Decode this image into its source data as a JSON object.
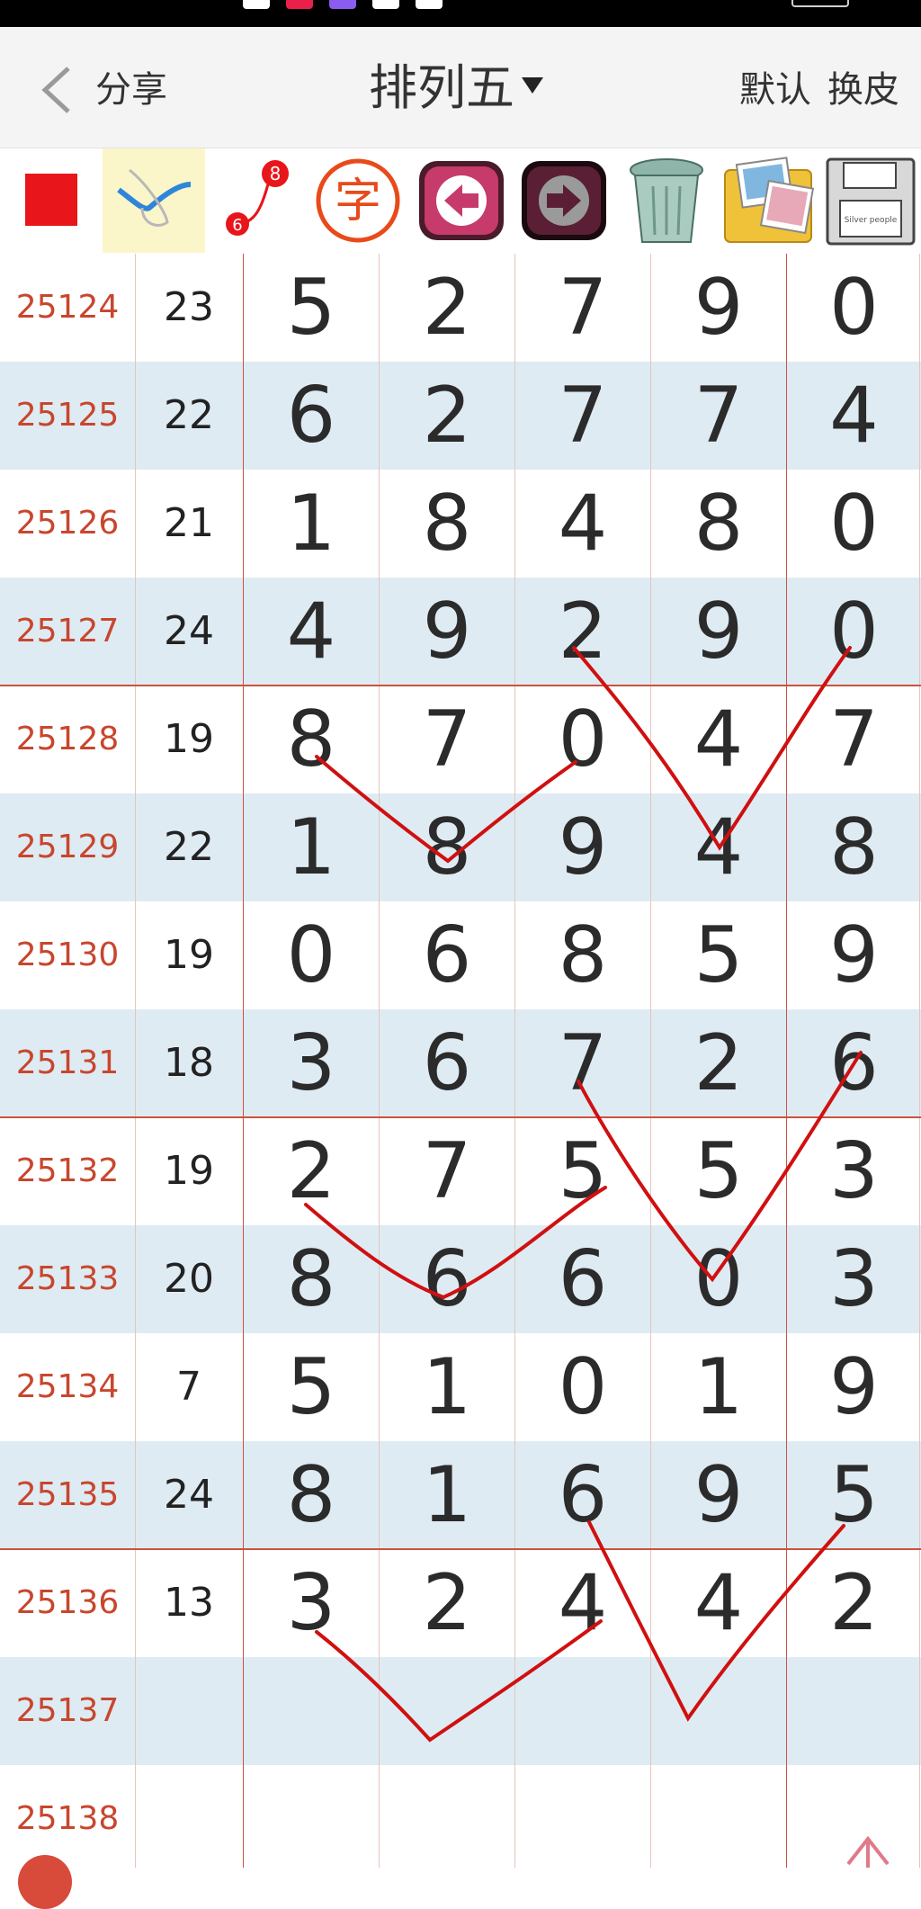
{
  "header": {
    "share_label": "分享",
    "title": "排列五",
    "default_label": "默认",
    "skin_label": "换皮"
  },
  "toolbar": {
    "tools": [
      {
        "icon": "red-square-icon"
      },
      {
        "icon": "check-pen-icon"
      },
      {
        "icon": "connect-dots-icon",
        "small_label_a": "6",
        "small_label_b": "8"
      },
      {
        "icon": "char-icon",
        "label": "字"
      },
      {
        "icon": "arrow-left-icon"
      },
      {
        "icon": "arrow-right-icon"
      },
      {
        "icon": "trash-icon"
      },
      {
        "icon": "photos-icon"
      },
      {
        "icon": "save-disk-icon",
        "label": "Silver people"
      }
    ]
  },
  "grid": {
    "rows": [
      {
        "period": "25124",
        "sum": "23",
        "digits": [
          "5",
          "2",
          "7",
          "9",
          "0"
        ]
      },
      {
        "period": "25125",
        "sum": "22",
        "digits": [
          "6",
          "2",
          "7",
          "7",
          "4"
        ]
      },
      {
        "period": "25126",
        "sum": "21",
        "digits": [
          "1",
          "8",
          "4",
          "8",
          "0"
        ]
      },
      {
        "period": "25127",
        "sum": "24",
        "digits": [
          "4",
          "9",
          "2",
          "9",
          "0"
        ]
      },
      {
        "period": "25128",
        "sum": "19",
        "digits": [
          "8",
          "7",
          "0",
          "4",
          "7"
        ]
      },
      {
        "period": "25129",
        "sum": "22",
        "digits": [
          "1",
          "8",
          "9",
          "4",
          "8"
        ]
      },
      {
        "period": "25130",
        "sum": "19",
        "digits": [
          "0",
          "6",
          "8",
          "5",
          "9"
        ]
      },
      {
        "period": "25131",
        "sum": "18",
        "digits": [
          "3",
          "6",
          "7",
          "2",
          "6"
        ]
      },
      {
        "period": "25132",
        "sum": "19",
        "digits": [
          "2",
          "7",
          "5",
          "5",
          "3"
        ]
      },
      {
        "period": "25133",
        "sum": "20",
        "digits": [
          "8",
          "6",
          "6",
          "0",
          "3"
        ]
      },
      {
        "period": "25134",
        "sum": "7",
        "digits": [
          "5",
          "1",
          "0",
          "1",
          "9"
        ]
      },
      {
        "period": "25135",
        "sum": "24",
        "digits": [
          "8",
          "1",
          "6",
          "9",
          "5"
        ]
      },
      {
        "period": "25136",
        "sum": "13",
        "digits": [
          "3",
          "2",
          "4",
          "4",
          "2"
        ]
      },
      {
        "period": "25137",
        "sum": "",
        "digits": [
          "",
          "",
          "",
          "",
          ""
        ]
      },
      {
        "period": "25138",
        "sum": "",
        "digits": [
          "",
          "",
          "",
          "",
          ""
        ]
      }
    ]
  },
  "colors": {
    "period_text": "#c8462d",
    "row_alt": "#deebf3",
    "grid_line": "#c9533e",
    "trend_line": "#d01010"
  }
}
